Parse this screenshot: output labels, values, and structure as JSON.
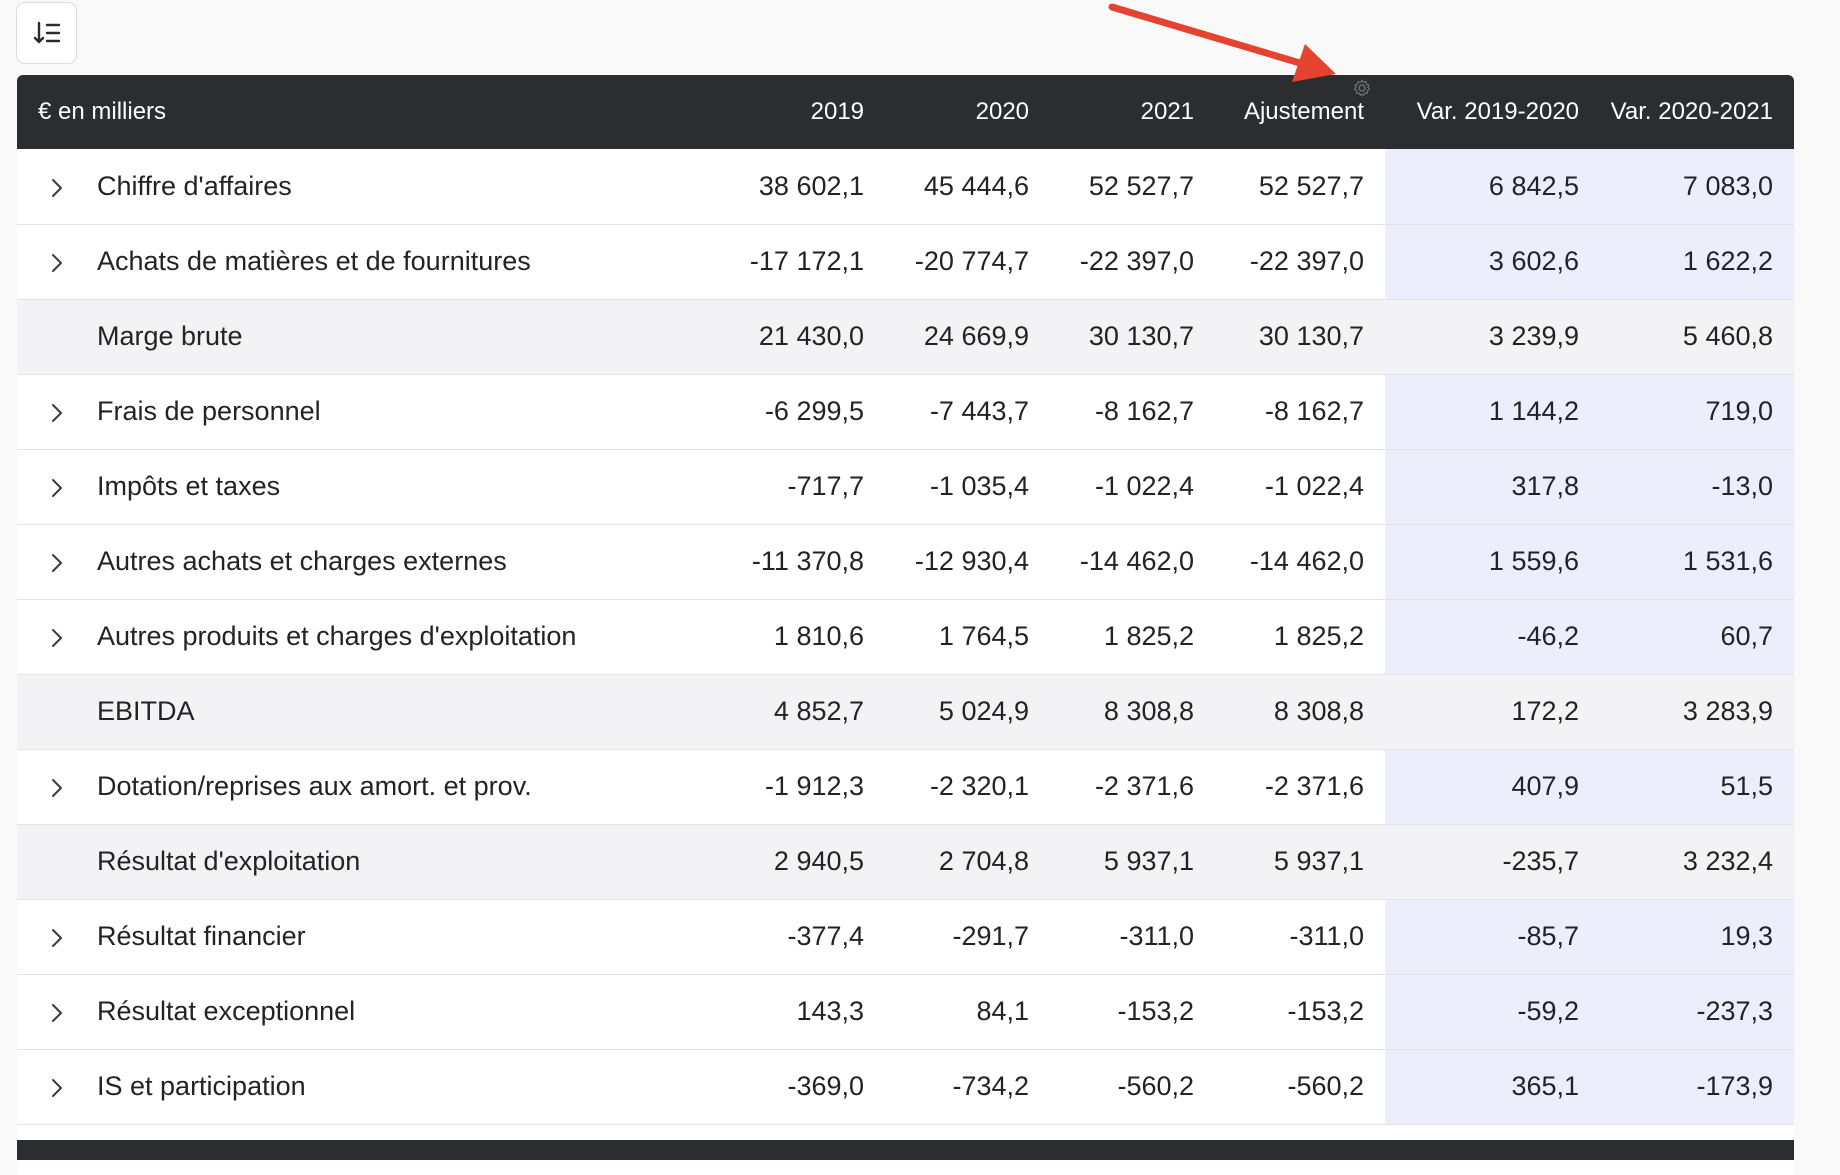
{
  "toolbar": {
    "sort_icon": "sort-descending-icon"
  },
  "table": {
    "headers": [
      "€ en milliers",
      "2019",
      "2020",
      "2021",
      "Ajustement",
      "Var. 2019-2020",
      "Var. 2020-2021"
    ],
    "header_icon": "gear-icon",
    "rows": [
      {
        "label": "Chiffre d'affaires",
        "expandable": true,
        "subtotal": false,
        "values": [
          "38 602,1",
          "45 444,6",
          "52 527,7",
          "52 527,7",
          "6 842,5",
          "7 083,0"
        ]
      },
      {
        "label": "Achats de matières et de fournitures",
        "expandable": true,
        "subtotal": false,
        "values": [
          "-17 172,1",
          "-20 774,7",
          "-22 397,0",
          "-22 397,0",
          "3 602,6",
          "1 622,2"
        ]
      },
      {
        "label": "Marge brute",
        "expandable": false,
        "subtotal": true,
        "values": [
          "21 430,0",
          "24 669,9",
          "30 130,7",
          "30 130,7",
          "3 239,9",
          "5 460,8"
        ]
      },
      {
        "label": "Frais de personnel",
        "expandable": true,
        "subtotal": false,
        "values": [
          "-6 299,5",
          "-7 443,7",
          "-8 162,7",
          "-8 162,7",
          "1 144,2",
          "719,0"
        ]
      },
      {
        "label": "Impôts et taxes",
        "expandable": true,
        "subtotal": false,
        "values": [
          "-717,7",
          "-1 035,4",
          "-1 022,4",
          "-1 022,4",
          "317,8",
          "-13,0"
        ]
      },
      {
        "label": "Autres achats et charges externes",
        "expandable": true,
        "subtotal": false,
        "values": [
          "-11 370,8",
          "-12 930,4",
          "-14 462,0",
          "-14 462,0",
          "1 559,6",
          "1 531,6"
        ]
      },
      {
        "label": "Autres produits et charges d'exploitation",
        "expandable": true,
        "subtotal": false,
        "values": [
          "1 810,6",
          "1 764,5",
          "1 825,2",
          "1 825,2",
          "-46,2",
          "60,7"
        ]
      },
      {
        "label": "EBITDA",
        "expandable": false,
        "subtotal": true,
        "values": [
          "4 852,7",
          "5 024,9",
          "8 308,8",
          "8 308,8",
          "172,2",
          "3 283,9"
        ]
      },
      {
        "label": "Dotation/reprises aux amort. et prov.",
        "expandable": true,
        "subtotal": false,
        "values": [
          "-1 912,3",
          "-2 320,1",
          "-2 371,6",
          "-2 371,6",
          "407,9",
          "51,5"
        ]
      },
      {
        "label": "Résultat d'exploitation",
        "expandable": false,
        "subtotal": true,
        "values": [
          "2 940,5",
          "2 704,8",
          "5 937,1",
          "5 937,1",
          "-235,7",
          "3 232,4"
        ]
      },
      {
        "label": "Résultat financier",
        "expandable": true,
        "subtotal": false,
        "values": [
          "-377,4",
          "-291,7",
          "-311,0",
          "-311,0",
          "-85,7",
          "19,3"
        ]
      },
      {
        "label": "Résultat exceptionnel",
        "expandable": true,
        "subtotal": false,
        "values": [
          "143,3",
          "84,1",
          "-153,2",
          "-153,2",
          "-59,2",
          "-237,3"
        ]
      },
      {
        "label": "IS et participation",
        "expandable": true,
        "subtotal": false,
        "values": [
          "-369,0",
          "-734,2",
          "-560,2",
          "-560,2",
          "365,1",
          "-173,9"
        ]
      }
    ]
  },
  "annotation": {
    "arrow_color": "#e5432f"
  },
  "colors": {
    "header_bg": "#2c2d30",
    "variance_bg": "#eceefc",
    "subtotal_bg": "#f3f3f5",
    "row_border": "#e3e3e6"
  }
}
